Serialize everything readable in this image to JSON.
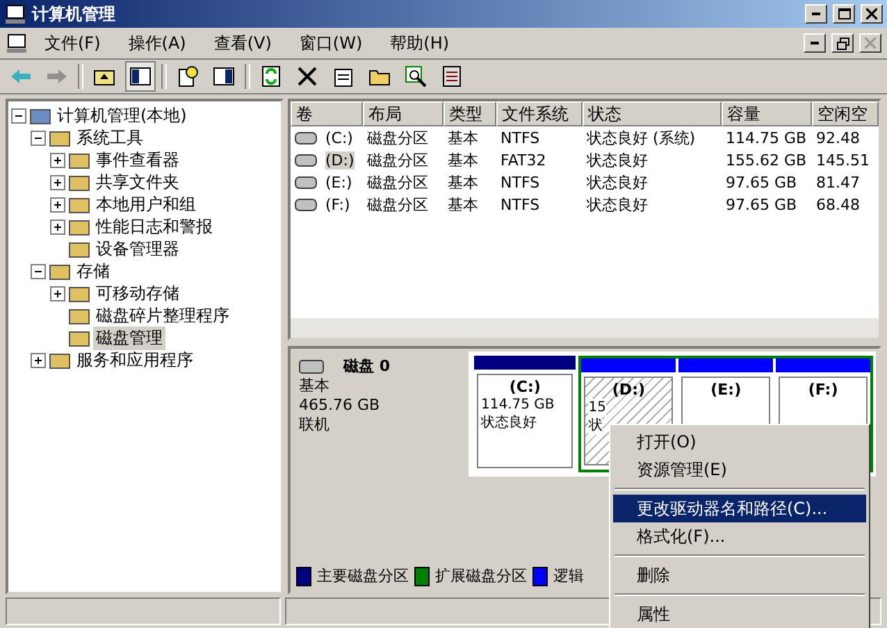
{
  "window": {
    "title": "计算机管理"
  },
  "menu_bar": [
    "文件(F)",
    "操作(A)",
    "查看(V)",
    "窗口(W)",
    "帮助(H)"
  ],
  "tree": [
    {
      "label": "计算机管理(本地)",
      "expanded": true,
      "selected": false,
      "children": [
        {
          "label": "系统工具",
          "expanded": true,
          "selected": false,
          "children": [
            {
              "label": "事件查看器",
              "expanded": false,
              "selected": false
            },
            {
              "label": "共享文件夹",
              "expanded": false,
              "selected": false
            },
            {
              "label": "本地用户和组",
              "expanded": false,
              "selected": false
            },
            {
              "label": "性能日志和警报",
              "expanded": false,
              "selected": false
            },
            {
              "label": "设备管理器",
              "selected": false
            }
          ]
        },
        {
          "label": "存储",
          "expanded": true,
          "selected": false,
          "children": [
            {
              "label": "可移动存储",
              "expanded": false,
              "selected": false
            },
            {
              "label": "磁盘碎片整理程序",
              "selected": false
            },
            {
              "label": "磁盘管理",
              "selected": true
            }
          ]
        },
        {
          "label": "服务和应用程序",
          "expanded": false,
          "selected": false
        }
      ]
    }
  ],
  "table": {
    "columns": [
      "卷",
      "布局",
      "类型",
      "文件系统",
      "状态",
      "容量",
      "空闲空"
    ],
    "rows": [
      {
        "selected": false,
        "cells": [
          "(C:)",
          "磁盘分区",
          "基本",
          "NTFS",
          "状态良好 (系统)",
          "114.75 GB",
          "92.48"
        ]
      },
      {
        "selected": true,
        "cells": [
          "(D:)",
          "磁盘分区",
          "基本",
          "FAT32",
          "状态良好",
          "155.62 GB",
          "145.51"
        ]
      },
      {
        "selected": false,
        "cells": [
          "(E:)",
          "磁盘分区",
          "基本",
          "NTFS",
          "状态良好",
          "97.65 GB",
          "81.47"
        ]
      },
      {
        "selected": false,
        "cells": [
          "(F:)",
          "磁盘分区",
          "基本",
          "NTFS",
          "状态良好",
          "97.65 GB",
          "68.48"
        ]
      }
    ]
  },
  "disk": {
    "name": "磁盘 0",
    "type": "基本",
    "size": "465.76 GB",
    "status": "联机",
    "partitions": [
      {
        "kind": "primary",
        "label": "(C:)",
        "size": "114.75 GB",
        "status": "状态良好",
        "selected": false
      },
      {
        "kind": "logical",
        "label": "(D:)",
        "size": "15",
        "status": "状",
        "selected": true
      },
      {
        "kind": "logical",
        "label": "(E:)",
        "selected": false
      },
      {
        "kind": "logical",
        "label": "(F:)",
        "selected": false
      }
    ]
  },
  "legend": [
    {
      "label": "主要磁盘分区",
      "color": "#000080"
    },
    {
      "label": "扩展磁盘分区",
      "color": "#008000"
    },
    {
      "label": "逻辑",
      "color": "#0000ff"
    }
  ],
  "context_menu": [
    {
      "kind": "item",
      "label": "打开(O)",
      "selected": false
    },
    {
      "kind": "item",
      "label": "资源管理(E)",
      "selected": false
    },
    {
      "kind": "separator"
    },
    {
      "kind": "item",
      "label": "更改驱动器名和路径(C)...",
      "selected": true
    },
    {
      "kind": "item",
      "label": "格式化(F)...",
      "selected": false
    },
    {
      "kind": "separator"
    },
    {
      "kind": "item",
      "label": "删除",
      "selected": false
    },
    {
      "kind": "separator"
    },
    {
      "kind": "item",
      "label": "属性",
      "selected": false
    }
  ]
}
